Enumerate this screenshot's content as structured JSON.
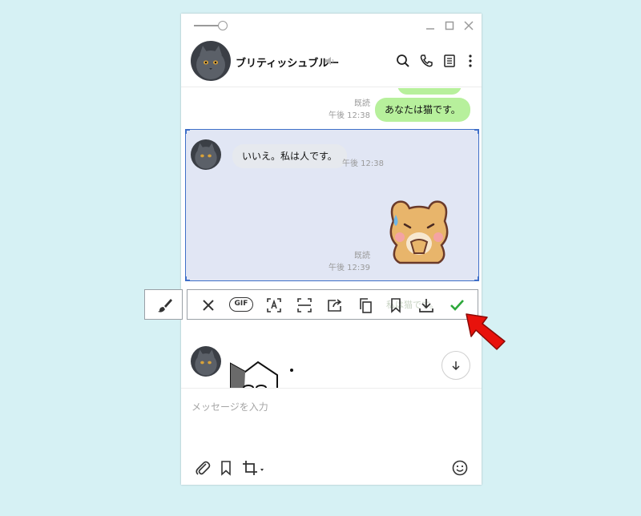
{
  "header": {
    "contact_name": "ブリティッシュブルー"
  },
  "messages": [
    {
      "sender": "me",
      "text": "あなたは猫です。",
      "read": "既読",
      "time": "午後 12:38"
    },
    {
      "sender": "other",
      "text": "いいえ。私は人です。",
      "time": "午後 12:38"
    },
    {
      "sender": "me",
      "type": "sticker",
      "sticker": "crying-dog-sticker",
      "read": "既読",
      "time": "午後 12:39"
    },
    {
      "sender": "other",
      "type": "sticker",
      "sticker": "cat-sticker"
    }
  ],
  "toolbar": {
    "gif_label": "GIF",
    "buttons": [
      "close-icon",
      "gif-icon",
      "text-recognition-icon",
      "scan-icon",
      "share-icon",
      "copy-icon",
      "bookmark-icon",
      "download-icon",
      "check-icon"
    ],
    "hidden_text": "私は猫です。"
  },
  "input": {
    "placeholder": "メッセージを入力"
  },
  "colors": {
    "background": "#d6f1f4",
    "my_bubble": "#b7f09c",
    "other_bubble": "#e6e9ee",
    "selection": "#e1e6f4",
    "selection_border": "#3f6fc8",
    "confirm": "#2da83b",
    "arrow": "#e8120c"
  }
}
